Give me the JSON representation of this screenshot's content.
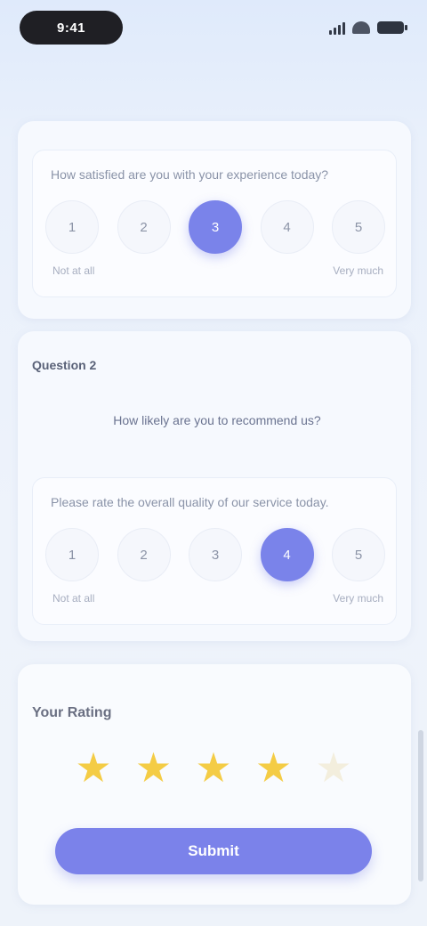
{
  "status_bar": {
    "time": "9:41",
    "signal_icon": "signal-bars-icon",
    "wifi_icon": "wifi-icon",
    "battery_icon": "battery-icon"
  },
  "question_1": {
    "text": "How satisfied are you with your experience today?",
    "options": [
      "1",
      "2",
      "3",
      "4",
      "5"
    ],
    "selected_index": 2,
    "low_label": "Not at all",
    "high_label": "Very much"
  },
  "section_2": {
    "title": "Question 2",
    "text": "How likely are you to recommend us?"
  },
  "question_2": {
    "text": "Please rate the overall quality of our service today.",
    "options": [
      "1",
      "2",
      "3",
      "4",
      "5"
    ],
    "selected_index": 3,
    "low_label": "Not at all",
    "high_label": "Very much"
  },
  "rating": {
    "title": "Your Rating",
    "value": 4,
    "max": 5,
    "star_icon": "star-icon"
  },
  "submit": {
    "label": "Submit"
  },
  "colors": {
    "accent": "#7a83ea",
    "star": "#f4cc45",
    "background": "#e9f0fb"
  }
}
